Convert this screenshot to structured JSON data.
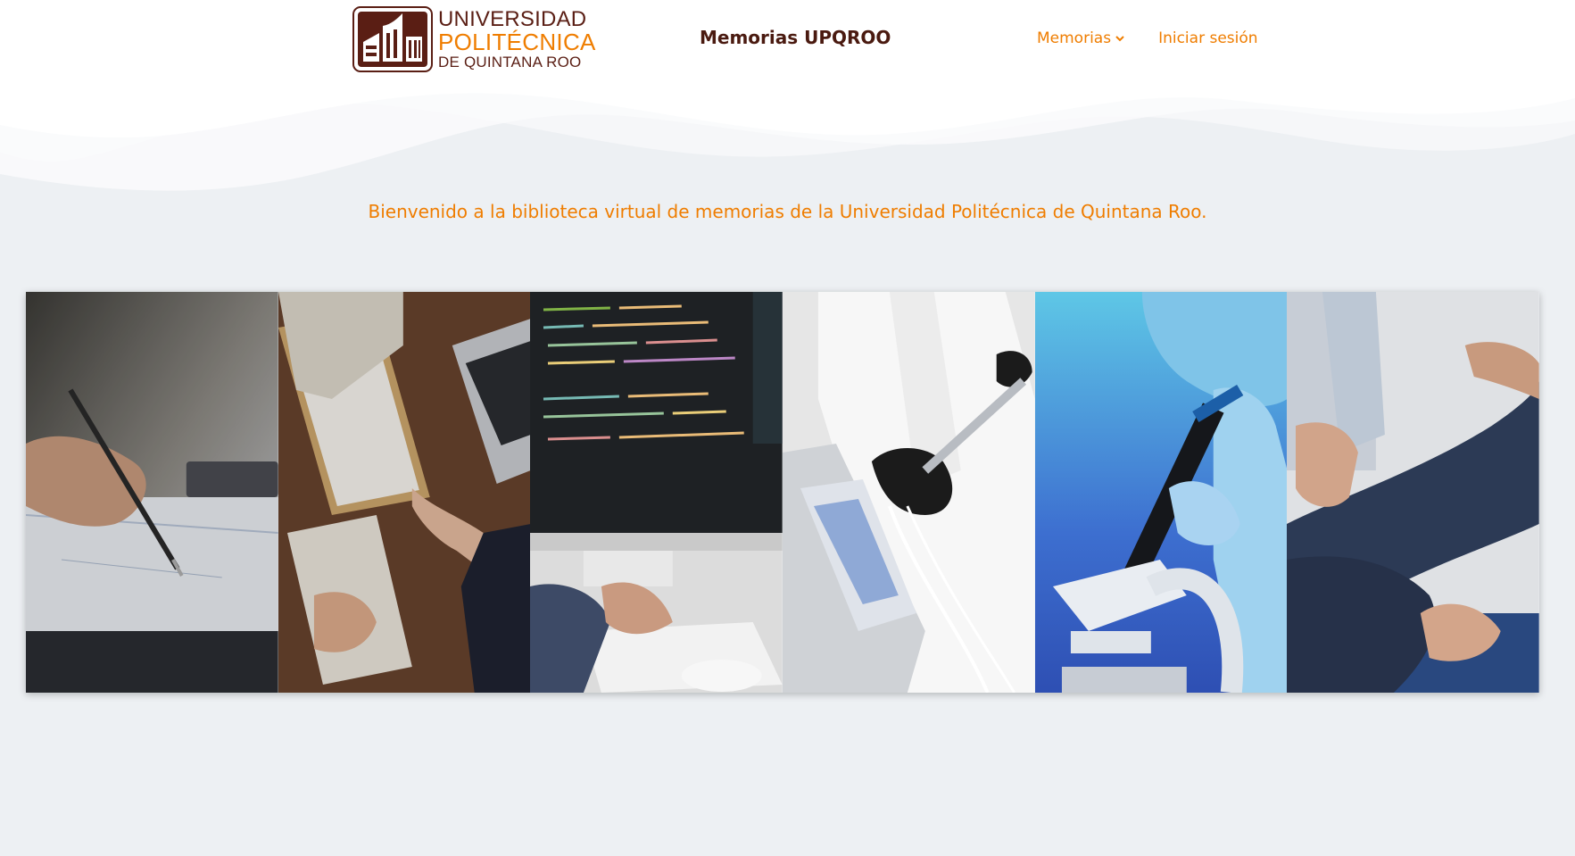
{
  "header": {
    "logo": {
      "line1": "UNIVERSIDAD",
      "line2": "POLITÉCNICA",
      "line3": "DE QUINTANA ROO"
    },
    "site_title": "Memorias UPQROO",
    "nav": {
      "memorias_label": "Memorias",
      "login_label": "Iniciar sesión"
    }
  },
  "hero": {
    "welcome_text": "Bienvenido a la biblioteca virtual de memorias de la Universidad Politécnica de Quintana Roo."
  },
  "gallery": {
    "panels": [
      {
        "subject": "finance-document-photo"
      },
      {
        "subject": "business-handshake-photo"
      },
      {
        "subject": "programming-computer-photo"
      },
      {
        "subject": "dental-instrument-photo"
      },
      {
        "subject": "microscope-lab-photo"
      },
      {
        "subject": "physiotherapy-photo"
      }
    ]
  },
  "colors": {
    "accent": "#ef7d00",
    "brand_dark": "#5a1e14",
    "background": "#edf0f3"
  }
}
